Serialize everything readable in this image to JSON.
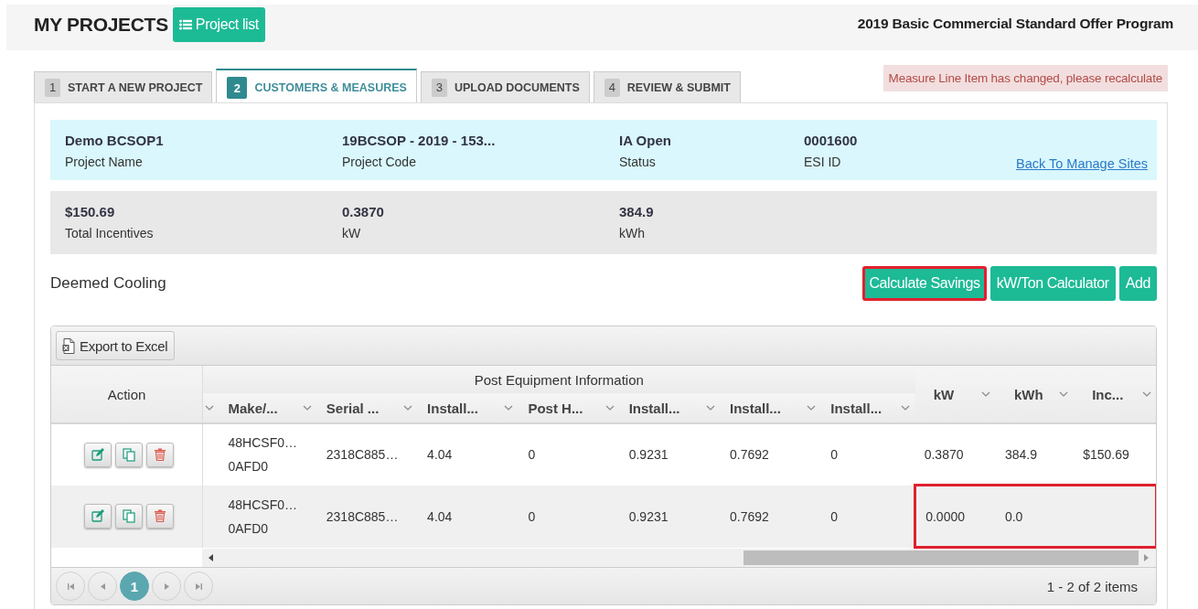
{
  "header": {
    "title": "MY PROJECTS",
    "list_button": "Project list",
    "program": "2019 Basic Commercial Standard Offer Program"
  },
  "tabs": [
    {
      "number": "1",
      "label": "START A NEW PROJECT",
      "selected": false
    },
    {
      "number": "2",
      "label": "CUSTOMERS & MEASURES",
      "selected": true
    },
    {
      "number": "3",
      "label": "UPLOAD DOCUMENTS",
      "selected": false
    },
    {
      "number": "4",
      "label": "REVIEW & SUBMIT",
      "selected": false
    }
  ],
  "alert": "Measure Line Item has changed, please recalculate",
  "project_info": [
    {
      "value": "Demo BCSOP1",
      "label": "Project Name"
    },
    {
      "value": "19BCSOP - 2019 - 153...",
      "label": "Project Code"
    },
    {
      "value": "IA Open",
      "label": "Status"
    },
    {
      "value": "0001600",
      "label": "ESI ID"
    }
  ],
  "back_link": "Back To Manage Sites",
  "totals": [
    {
      "value": "$150.69",
      "label": "Total Incentives"
    },
    {
      "value": "0.3870",
      "label": "kW"
    },
    {
      "value": "384.9",
      "label": "kWh"
    }
  ],
  "section": {
    "title": "Deemed Cooling",
    "buttons": [
      {
        "label": "Calculate Savings",
        "highlighted": true
      },
      {
        "label": "kW/Ton Calculator",
        "highlighted": false
      },
      {
        "label": "Add",
        "highlighted": false
      }
    ]
  },
  "grid": {
    "export_button": "Export to Excel",
    "action_header": "Action",
    "group_header": "Post Equipment Information",
    "columns": [
      {
        "label": "Make/...",
        "kind": "post"
      },
      {
        "label": "Serial ...",
        "kind": "post"
      },
      {
        "label": "Install...",
        "kind": "post"
      },
      {
        "label": "Post H...",
        "kind": "post"
      },
      {
        "label": "Install...",
        "kind": "post"
      },
      {
        "label": "Install...",
        "kind": "post"
      },
      {
        "label": "Install...",
        "kind": "post"
      },
      {
        "label": "kW",
        "kind": "result"
      },
      {
        "label": "kWh",
        "kind": "result"
      },
      {
        "label": "Inc...",
        "kind": "result"
      }
    ],
    "rows": [
      {
        "highlighted": false,
        "cells": [
          [
            "48HCSF0…",
            "0AFD0"
          ],
          "2318C885…",
          "4.04",
          "0",
          "0.9231",
          "0.7692",
          "0",
          "0.3870",
          "384.9",
          "$150.69"
        ]
      },
      {
        "highlighted": true,
        "cells": [
          [
            "48HCSF0…",
            "0AFD0"
          ],
          "2318C885…",
          "4.04",
          "0",
          "0.9231",
          "0.7692",
          "0",
          "0.0000",
          "0.0",
          null
        ]
      }
    ],
    "pager": {
      "pages": [
        {
          "label": "1",
          "selected": true
        }
      ],
      "info": "1 - 2 of 2 items"
    }
  }
}
